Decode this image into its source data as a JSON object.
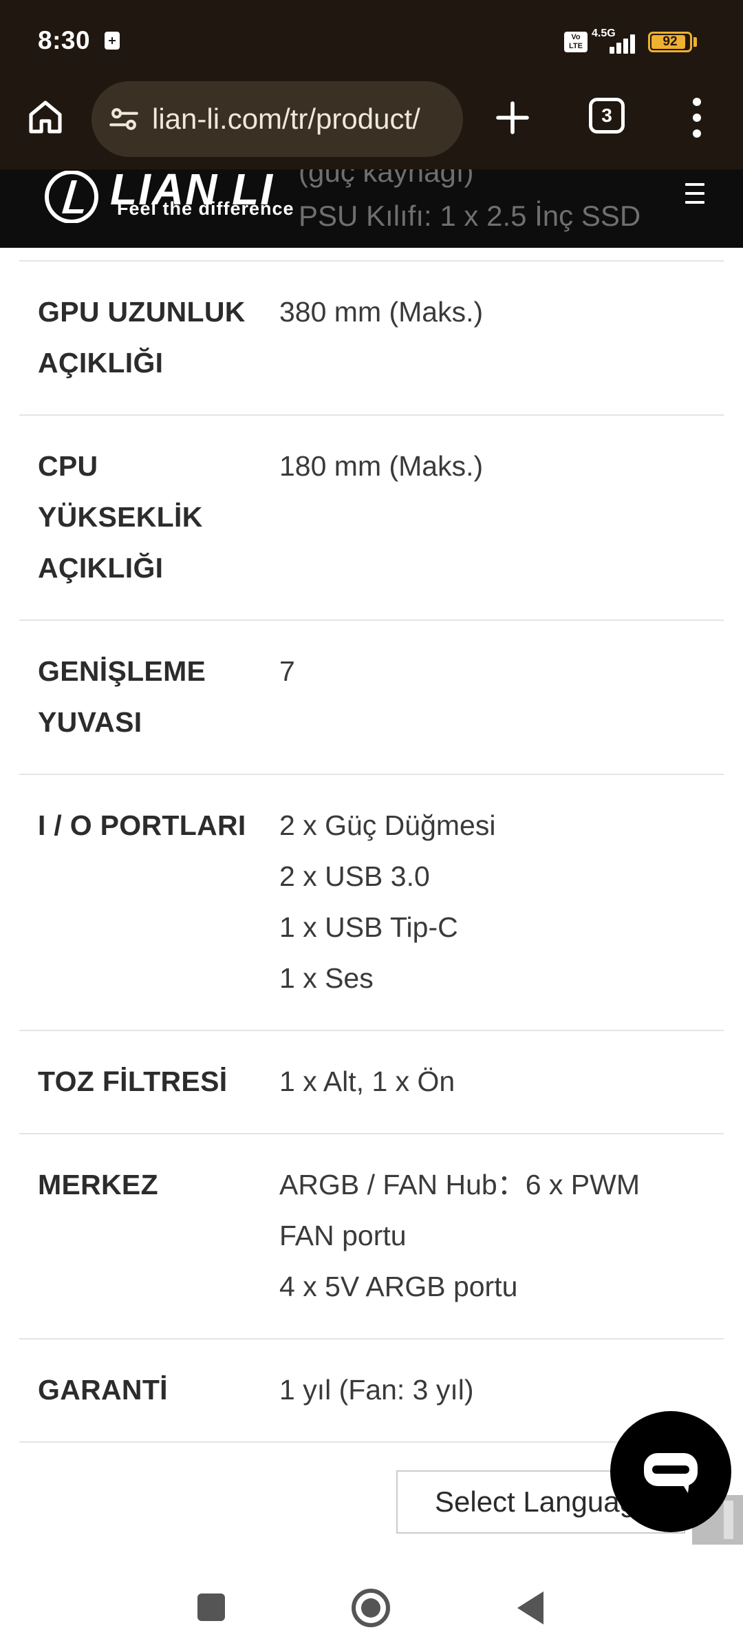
{
  "status_bar": {
    "time": "8:30",
    "volte_badge": "Vo LTE",
    "network": "4.5G",
    "battery_level": "92",
    "battery_fraction": 0.92
  },
  "browser": {
    "url": "lian-li.com/tr/product/",
    "tab_count": "3"
  },
  "site_header": {
    "brand": "LIAN LI",
    "tagline": "Feel the difference",
    "overlapped_text_1": "(güç kaynağı)",
    "overlapped_text_2": "PSU Kılıfı: 1 x 2.5 İnç SSD"
  },
  "specs": [
    {
      "label": "GPU UZUNLUK AÇIKLIĞI",
      "values": [
        "380 mm (Maks.)"
      ]
    },
    {
      "label": "CPU YÜKSEKLİK AÇIKLIĞI",
      "values": [
        "180 mm (Maks.)"
      ]
    },
    {
      "label": "GENİŞLEME YUVASI",
      "values": [
        "7"
      ]
    },
    {
      "label": "I / O PORTLARI",
      "values": [
        "2 x Güç Düğmesi",
        "2 x USB 3.0",
        "1 x USB Tip-C",
        "1 x Ses"
      ]
    },
    {
      "label": "TOZ FİLTRESİ",
      "values": [
        "1 x Alt, 1 x Ön"
      ]
    },
    {
      "label": "MERKEZ",
      "values": [
        "ARGB / FAN Hub：6 x PWM",
        "FAN portu",
        "4 x 5V ARGB portu"
      ]
    },
    {
      "label": "GARANTİ",
      "values": [
        "1 yıl (Fan: 3 yıl)"
      ]
    }
  ],
  "footer": {
    "language_select": "Select Language"
  },
  "colors": {
    "chrome_bg": "#201810",
    "urlbar_bg": "#3b3024",
    "header_bg": "#0d0d0d",
    "battery": "#f0b030"
  },
  "icons": {
    "home": "home-icon",
    "site_info": "tune-icon",
    "new_tab": "plus-icon",
    "menu": "more-vert-icon",
    "hamburger": "hamburger-icon",
    "chat": "chat-icon"
  }
}
